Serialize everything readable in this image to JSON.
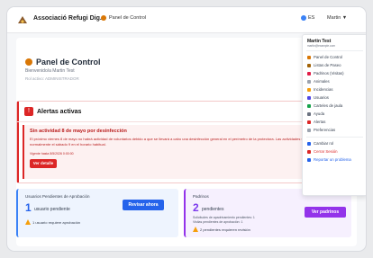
{
  "navbar": {
    "brand": "Associació Refugi Dig...",
    "link": "Panel de Control",
    "lang": "ES",
    "user": "Martin ▼"
  },
  "header": {
    "title": "Panel de Control",
    "welcome": "Bienvenido/a Martin Test",
    "role": "Rol activo: ADMINISTRADOR"
  },
  "alert": {
    "title": "Alertas activas",
    "subject": "Sin actividad 8 de mayo por desinfección",
    "text": "El próximo viernes 8 de mayo no habrá actividad de voluntarios debido a que se llevará a cabo una desinfección general en el perímetro de la protectora. Las actividades se retomarán normalmente el sábado 9 en el horario habitual.",
    "meta": "Vigente hasta 8/5/2026 0:00:00",
    "button": "Ver detalle"
  },
  "cards": {
    "left": {
      "label": "Usuarios Pendientes de Aprobación",
      "count": "1",
      "caption": "usuario pendiente",
      "warning": "1 usuario requiere aprobación",
      "button": "Revisar ahora"
    },
    "right": {
      "label": "Padrinos",
      "count": "2",
      "caption": "pendientes",
      "line1": "Solicitudes de apadrinamiento pendientes: 1",
      "line2": "Visitas pendientes de aprobación: 1",
      "warning": "2 pendientes requieren revisión",
      "button": "Ver padrinos"
    }
  },
  "dropdown": {
    "name": "Martin Test",
    "email": "martin@example.com",
    "items": [
      "Panel de Control",
      "Listas de Paseo",
      "Padrinos (Visitas)",
      "Animales",
      "Incidencias",
      "Usuarios",
      "Carteles de jaula",
      "Ayuda",
      "Alertas",
      "Preferencias"
    ],
    "change_role": "Cambiar rol",
    "logout": "Cerrar Sesión",
    "report": "Reportar un problema"
  },
  "colors": {
    "accent_blue": "#2563eb",
    "alert_red": "#dc2626",
    "purple": "#9333ea"
  }
}
